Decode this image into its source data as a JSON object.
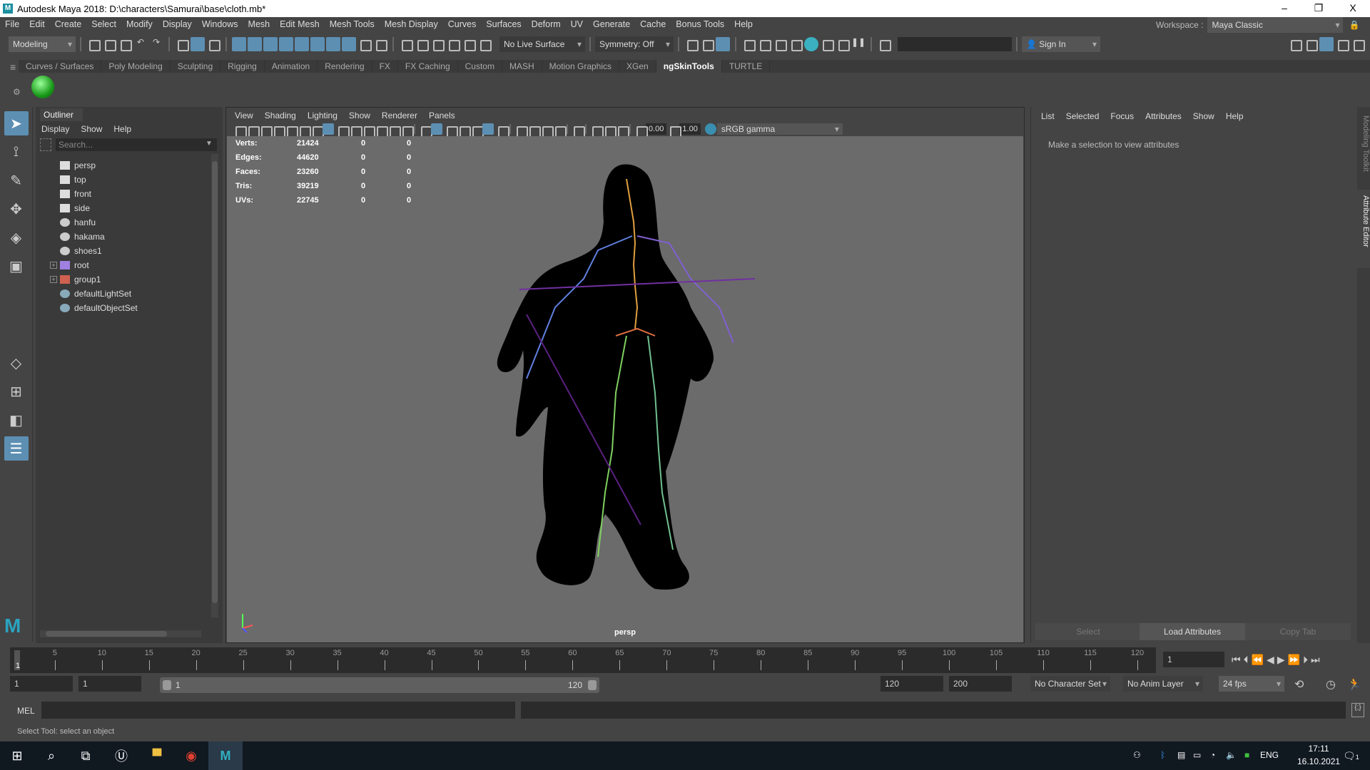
{
  "window": {
    "title": "Autodesk Maya 2018: D:\\characters\\Samurai\\base\\cloth.mb*",
    "logo": "M",
    "minimize": "–",
    "restore": "❐",
    "close": "X"
  },
  "menubar": [
    "File",
    "Edit",
    "Create",
    "Select",
    "Modify",
    "Display",
    "Windows",
    "Mesh",
    "Edit Mesh",
    "Mesh Tools",
    "Mesh Display",
    "Curves",
    "Surfaces",
    "Deform",
    "UV",
    "Generate",
    "Cache",
    "Bonus Tools",
    "Help"
  ],
  "workspace": {
    "label": "Workspace :",
    "value": "Maya Classic"
  },
  "statusline": {
    "mode": "Modeling",
    "live_surface": "No Live Surface",
    "symmetry": "Symmetry: Off",
    "sign_in": "Sign In"
  },
  "shelf": {
    "tabs": [
      "Curves / Surfaces",
      "Poly Modeling",
      "Sculpting",
      "Rigging",
      "Animation",
      "Rendering",
      "FX",
      "FX Caching",
      "Custom",
      "MASH",
      "Motion Graphics",
      "XGen",
      "ngSkinTools",
      "TURTLE"
    ],
    "active": "ngSkinTools"
  },
  "outliner": {
    "tab": "Outliner",
    "menus": [
      "Display",
      "Show",
      "Help"
    ],
    "search_placeholder": "Search...",
    "items": [
      {
        "label": "persp",
        "icon": "camera-icon",
        "expand": ""
      },
      {
        "label": "top",
        "icon": "camera-icon",
        "expand": ""
      },
      {
        "label": "front",
        "icon": "camera-icon",
        "expand": ""
      },
      {
        "label": "side",
        "icon": "camera-icon",
        "expand": ""
      },
      {
        "label": "hanfu",
        "icon": "mesh-icon",
        "expand": ""
      },
      {
        "label": "hakama",
        "icon": "mesh-icon",
        "expand": ""
      },
      {
        "label": "shoes1",
        "icon": "mesh-icon",
        "expand": ""
      },
      {
        "label": "root",
        "icon": "joint-icon",
        "expand": "+"
      },
      {
        "label": "group1",
        "icon": "group-icon",
        "expand": "+"
      },
      {
        "label": "defaultLightSet",
        "icon": "set-icon",
        "expand": ""
      },
      {
        "label": "defaultObjectSet",
        "icon": "set-icon",
        "expand": ""
      }
    ]
  },
  "viewport": {
    "menus": [
      "View",
      "Shading",
      "Lighting",
      "Show",
      "Renderer",
      "Panels"
    ],
    "exposure": "0.00",
    "gamma": "1.00",
    "colorspace": "sRGB gamma",
    "camera": "persp",
    "stats": [
      {
        "label": "Verts:",
        "total": "21424",
        "sel": "0",
        "comp": "0"
      },
      {
        "label": "Edges:",
        "total": "44620",
        "sel": "0",
        "comp": "0"
      },
      {
        "label": "Faces:",
        "total": "23260",
        "sel": "0",
        "comp": "0"
      },
      {
        "label": "Tris:",
        "total": "39219",
        "sel": "0",
        "comp": "0"
      },
      {
        "label": "UVs:",
        "total": "22745",
        "sel": "0",
        "comp": "0"
      }
    ]
  },
  "attribute_editor": {
    "menus": [
      "List",
      "Selected",
      "Focus",
      "Attributes",
      "Show",
      "Help"
    ],
    "message": "Make a selection to view attributes",
    "buttons": [
      "Select",
      "Load Attributes",
      "Copy Tab"
    ]
  },
  "side_tabs": [
    "Modeling Toolkit",
    "Attribute Editor"
  ],
  "timeline": {
    "labels": [
      "5",
      "10",
      "15",
      "20",
      "25",
      "30",
      "35",
      "40",
      "45",
      "50",
      "55",
      "60",
      "65",
      "70",
      "75",
      "80",
      "85",
      "90",
      "95",
      "100",
      "105",
      "110",
      "115",
      "120"
    ],
    "min": 1,
    "max": 120,
    "current_marker": "1",
    "current_frame": "1"
  },
  "range": {
    "start": "1",
    "anim_start": "1",
    "slider_start": "1",
    "slider_end": "120",
    "end": "120",
    "anim_end": "200",
    "character_set": "No Character Set",
    "anim_layer": "No Anim Layer",
    "fps": "24 fps"
  },
  "command": {
    "label": "MEL"
  },
  "helpline": "Select Tool: select an object",
  "taskbar": {
    "lang": "ENG",
    "time": "17:11",
    "date": "16.10.2021",
    "notifications": "1"
  }
}
